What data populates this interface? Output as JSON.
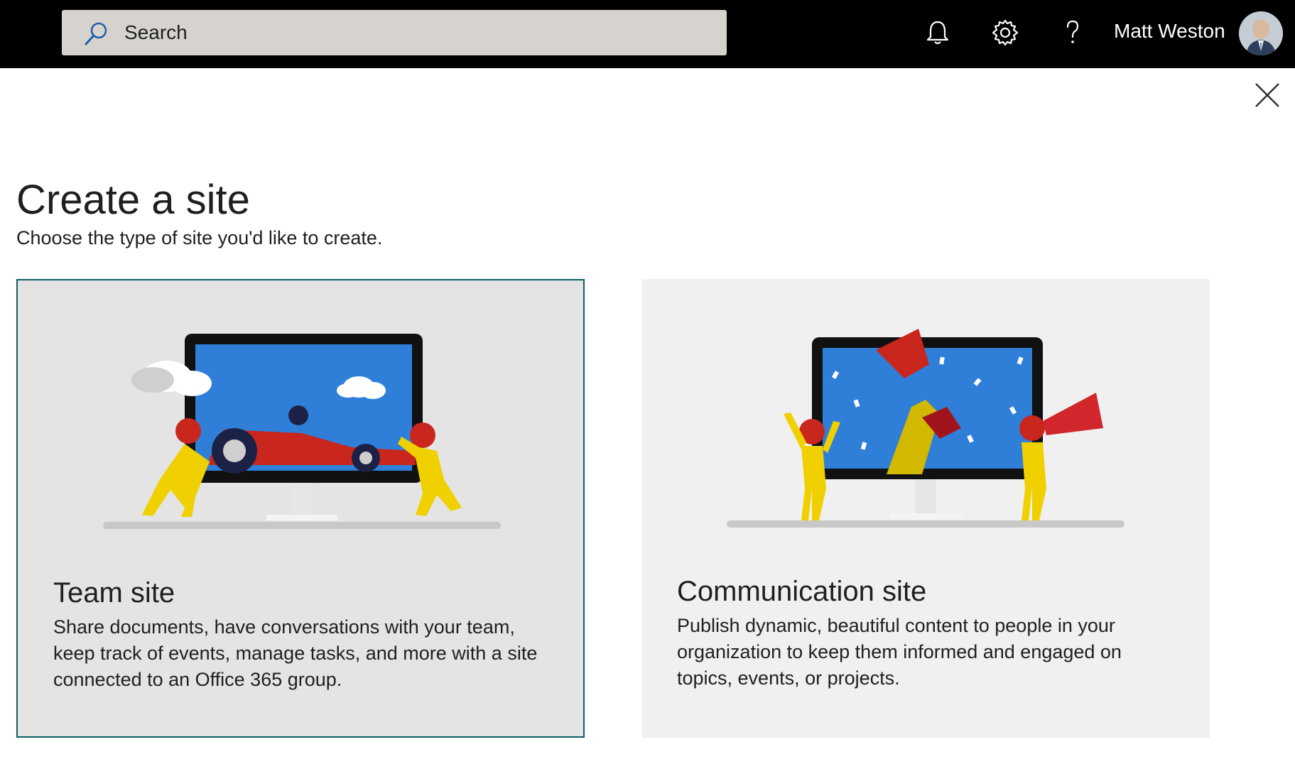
{
  "header": {
    "search_label": "Search",
    "user_name": "Matt Weston"
  },
  "page": {
    "title": "Create a site",
    "subtitle": "Choose the type of site you'd like to create."
  },
  "cards": [
    {
      "title": "Team site",
      "description": "Share documents, have conversations with your team, keep track of events, manage tasks, and more with a site connected to an Office 365 group."
    },
    {
      "title": "Communication site",
      "description": "Publish dynamic, beautiful content to people in your organization to keep them informed and engaged on topics, events, or projects."
    }
  ],
  "icons": {
    "search": "search-icon",
    "notifications": "bell-icon",
    "settings": "gear-icon",
    "help": "help-icon",
    "close": "close-icon"
  },
  "colors": {
    "topbar": "#000000",
    "search_bg": "#d6d3cf",
    "selected_border": "#0b5e63",
    "card_bg": "#f0f0f0"
  }
}
